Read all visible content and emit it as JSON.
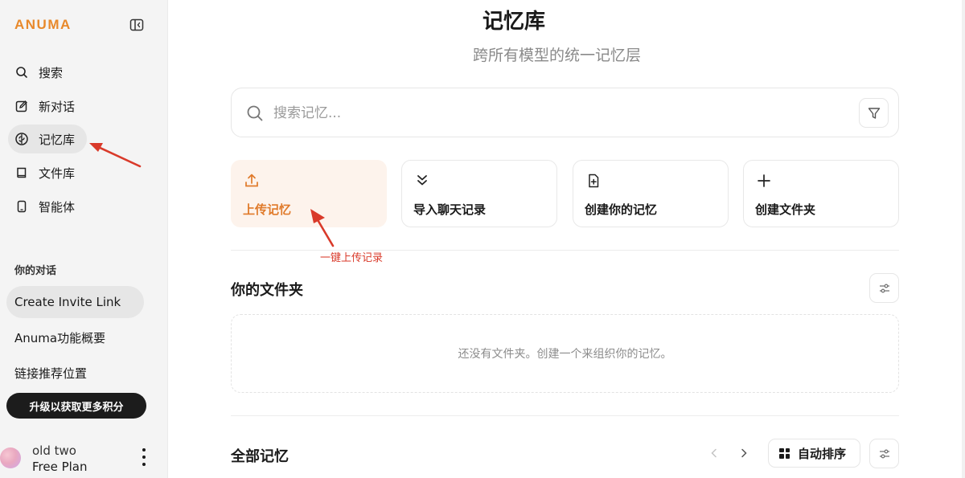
{
  "app": {
    "logo": "ANUMA",
    "brand_color": "#e8892b"
  },
  "sidebar": {
    "nav": [
      {
        "label": "搜索",
        "icon": "search-icon"
      },
      {
        "label": "新对话",
        "icon": "edit-icon"
      },
      {
        "label": "记忆库",
        "icon": "brain-icon",
        "active": true
      },
      {
        "label": "文件库",
        "icon": "book-icon"
      },
      {
        "label": "智能体",
        "icon": "phone-icon"
      }
    ],
    "section_label": "你的对话",
    "conversations": [
      {
        "label": "Create Invite Link"
      },
      {
        "label": "Anuma功能概要"
      },
      {
        "label": "链接推荐位置"
      }
    ],
    "upgrade_label": "升级以获取更多积分",
    "user": {
      "name": "old two",
      "plan": "Free Plan"
    }
  },
  "main": {
    "title": "记忆库",
    "subtitle": "跨所有模型的统一记忆层",
    "search": {
      "placeholder": "搜索记忆...",
      "value": ""
    },
    "actions": [
      {
        "label": "上传记忆",
        "icon": "upload-icon",
        "primary": true
      },
      {
        "label": "导入聊天记录",
        "icon": "import-chevrons-icon"
      },
      {
        "label": "创建你的记忆",
        "icon": "file-plus-icon"
      },
      {
        "label": "创建文件夹",
        "icon": "plus-icon"
      }
    ],
    "annotation": "一键上传记录",
    "folders": {
      "title": "你的文件夹",
      "empty_text": "还没有文件夹。创建一个来组织你的记忆。"
    },
    "all_memories": {
      "title": "全部记忆",
      "sort_label": "自动排序"
    }
  },
  "colors": {
    "accent": "#e07a2a",
    "annotation": "#d93a2a",
    "primary_card_bg": "#fdf3ec"
  }
}
